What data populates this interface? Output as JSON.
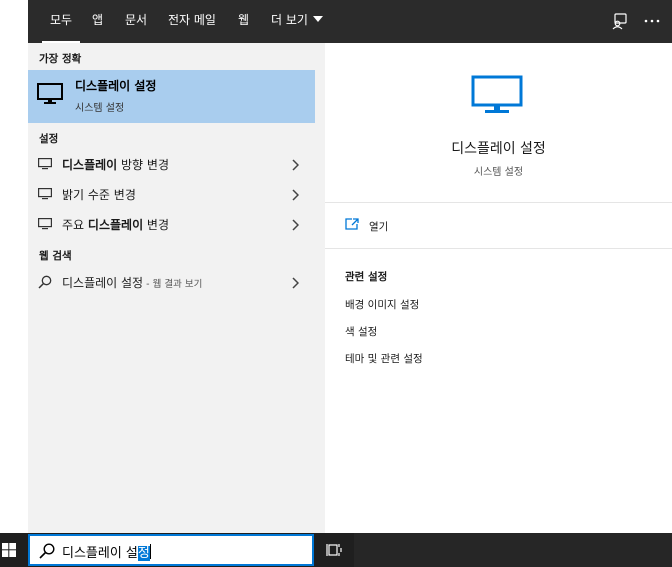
{
  "nav": {
    "tabs": [
      "모두",
      "앱",
      "문서",
      "전자 메일",
      "웹",
      "더 보기"
    ],
    "active_tab": "모두"
  },
  "left": {
    "best_match_header": "가장 정확",
    "best_match": {
      "title": "디스플레이 설정",
      "subtitle": "시스템 설정"
    },
    "settings_header": "설정",
    "settings_items": [
      {
        "bold": "디스플레이",
        "rest": " 방향 변경"
      },
      {
        "pre": "밝기 수준 변경"
      },
      {
        "pre": "주요 ",
        "bold": "디스플레이",
        "rest": " 변경"
      }
    ],
    "web_header": "웹 검색",
    "web_item": {
      "text": "디스플레이 설정",
      "suffix": " - 웹 결과 보기"
    }
  },
  "right": {
    "title": "디스플레이 설정",
    "subtitle": "시스템 설정",
    "open_label": "열기",
    "related_header": "관련 설정",
    "related_links": [
      "배경 이미지 설정",
      "색 설정",
      "테마 및 관련 설정"
    ]
  },
  "taskbar": {
    "search_text_plain": "디스플레이 설",
    "search_text_selected": "정"
  },
  "colors": {
    "accent": "#0078d7",
    "selected_bg": "#a9cdee",
    "nav_bg": "#2b2b2b",
    "panel_bg": "#f2f2f2"
  },
  "icons": [
    "monitor-icon",
    "chevron-right-icon",
    "search-icon",
    "open-icon",
    "feedback-icon",
    "more-icon",
    "windows-icon",
    "task-view-icon"
  ]
}
